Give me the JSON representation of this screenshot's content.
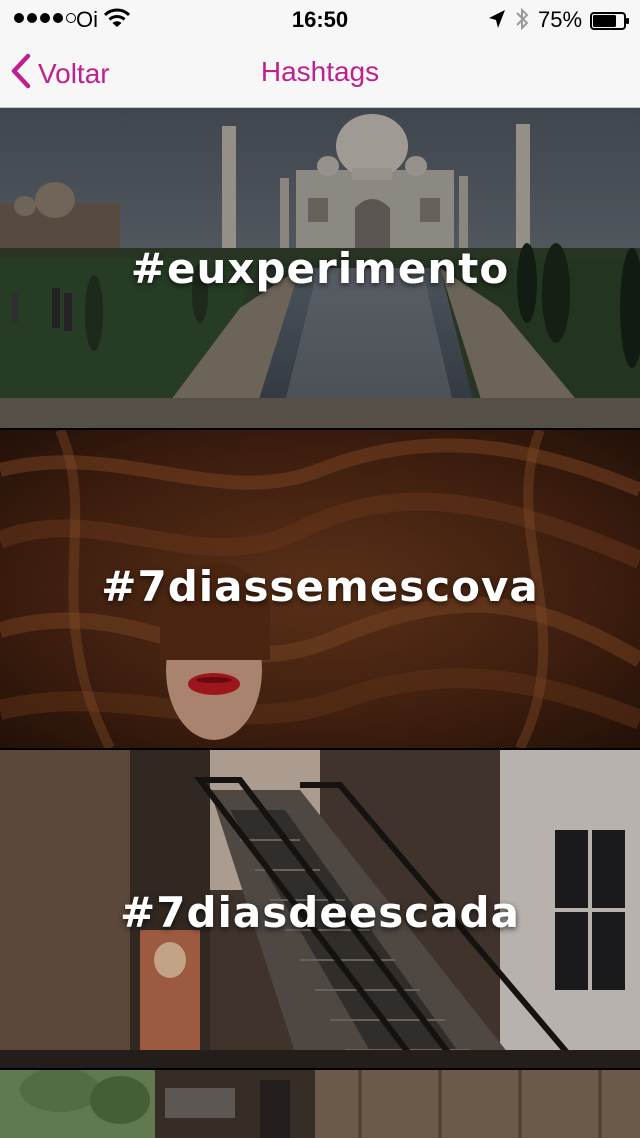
{
  "status_bar": {
    "carrier": "Oi",
    "time": "16:50",
    "battery_percent": "75%",
    "battery_level": 0.75,
    "signal_bars": 4,
    "icons": [
      "signal-dots-icon",
      "wifi-icon",
      "location-arrow-icon",
      "bluetooth-icon",
      "battery-icon"
    ]
  },
  "nav": {
    "back_label": "Voltar",
    "title": "Hashtags",
    "accent_color": "#c0208f"
  },
  "hashtags": [
    {
      "label": "#euxperimento",
      "image": "taj-mahal-photo"
    },
    {
      "label": "#7diassemescova",
      "image": "long-hair-woman-photo"
    },
    {
      "label": "#7diasdeescada",
      "image": "escalators-photo"
    },
    {
      "label": "",
      "image": "farm-barn-photo"
    }
  ]
}
